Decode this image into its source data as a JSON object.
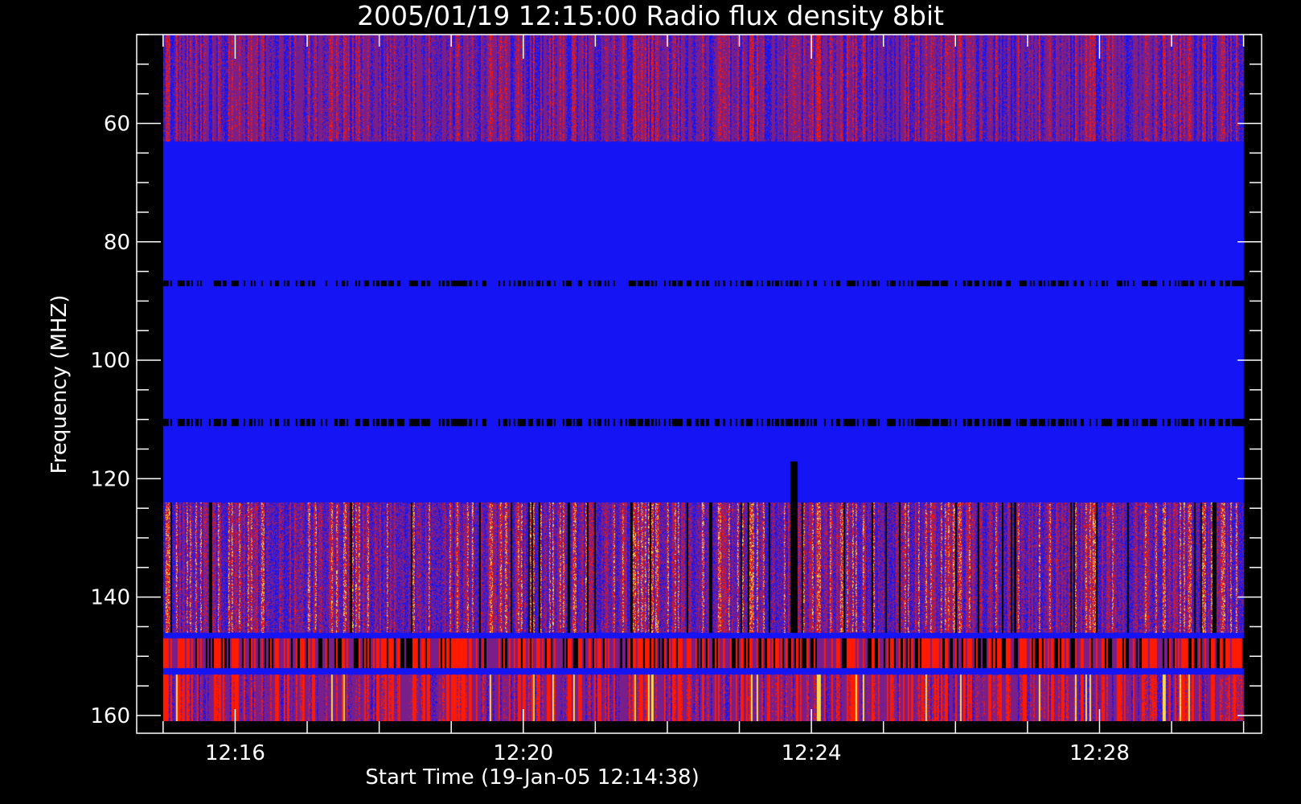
{
  "chart_data": {
    "type": "heatmap",
    "title": "2005/01/19 12:15:00 Radio flux density 8bit",
    "xlabel": "Start Time (19-Jan-05 12:14:38)",
    "ylabel": "Frequency (MHZ)",
    "x_range": [
      "12:14:38",
      "12:30:15"
    ],
    "data_x_range": [
      "12:15:00",
      "12:30:00"
    ],
    "y_range": [
      45,
      163
    ],
    "data_y_range": [
      45,
      161
    ],
    "y_inverted": true,
    "x_ticks": [
      "12:16",
      "12:20",
      "12:24",
      "12:28"
    ],
    "y_ticks": [
      "60",
      "80",
      "100",
      "120",
      "140",
      "160"
    ],
    "grid": false,
    "colors": {
      "background": "#000000",
      "axes": "#ffffff",
      "low": "#000000",
      "mid_low": "#1414f5",
      "mid": "#7a1f8a",
      "high": "#ff1a00",
      "peak": "#ffd84a"
    },
    "features": [
      {
        "type": "band",
        "freq_range": [
          147,
          152
        ],
        "intensity": "high",
        "pattern": "alternating red/black stripes"
      },
      {
        "type": "band",
        "freq_range": [
          153,
          161
        ],
        "intensity": "mid-high",
        "pattern": "red/purple stripes"
      },
      {
        "type": "band",
        "freq_range": [
          45,
          63
        ],
        "intensity": "mid",
        "pattern": "purple speckle"
      },
      {
        "type": "bursts",
        "freq_range": [
          124,
          146
        ],
        "intensity": "high",
        "pattern": "scattered red/yellow"
      },
      {
        "type": "dark_line",
        "freq": 110.5
      },
      {
        "type": "dark_line",
        "freq": 87
      },
      {
        "type": "dark_column",
        "time": "12:23:45",
        "freq_range": [
          117,
          146
        ]
      }
    ]
  }
}
